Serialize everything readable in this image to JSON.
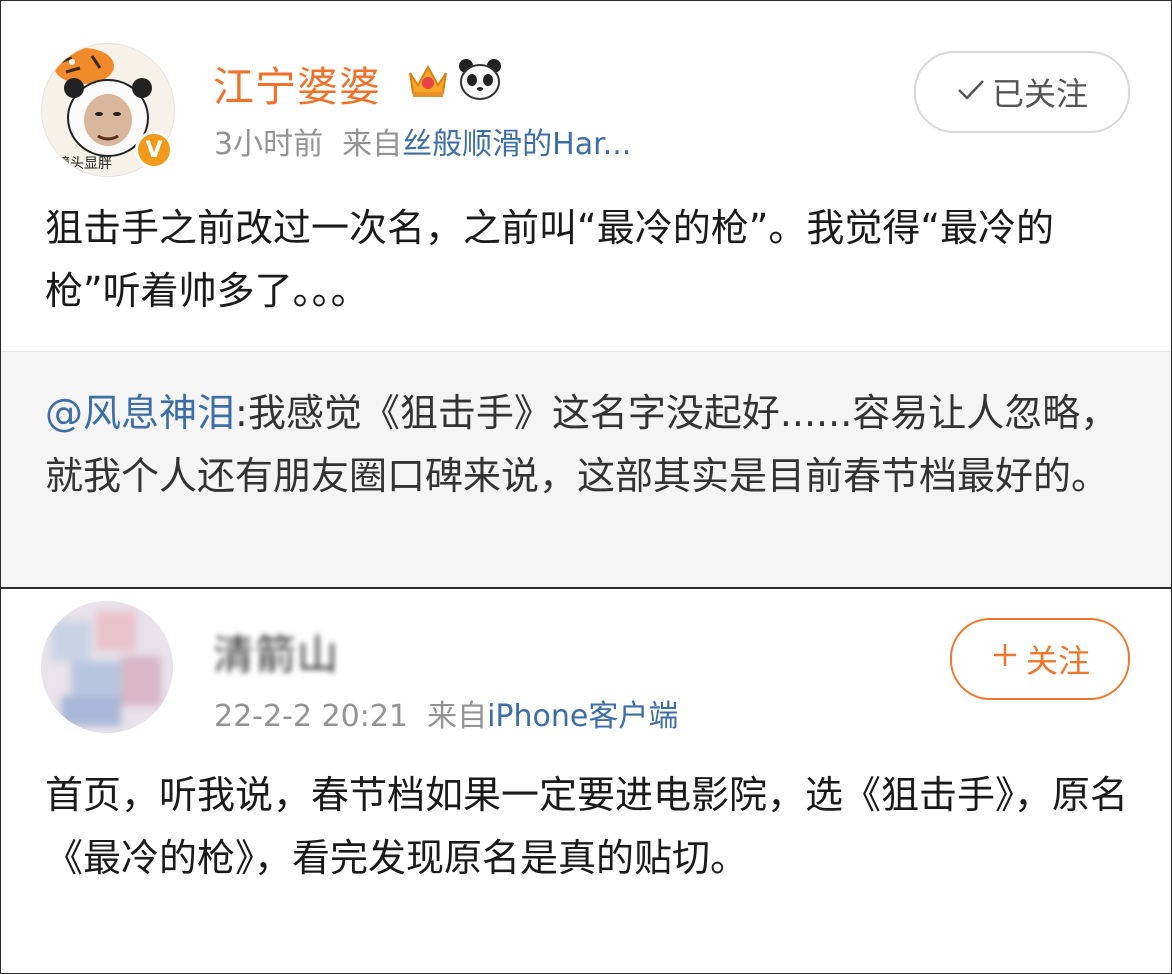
{
  "post1": {
    "avatar_caption": "镜头显胖",
    "username": "江宁婆婆",
    "badge_icons": [
      "crown-icon",
      "panda-icon"
    ],
    "verified_mark": "V",
    "time": "3小时前",
    "source_prefix": "来自",
    "source": "丝般顺滑的Har...",
    "follow_label": "已关注",
    "follow_icon": "check-icon",
    "text": "狙击手之前改过一次名，之前叫“最冷的枪”。我觉得“最冷的枪”听着帅多了。。。",
    "repost": {
      "mention": "@风息神泪",
      "text": ":我感觉《狙击手》这名字没起好......容易让人忽略，就我个人还有朋友圈口碑来说，这部其实是目前春节档最好的。"
    }
  },
  "post2": {
    "username": "清箭山",
    "time": "22-2-2 20:21",
    "source_prefix": "来自",
    "source": "iPhone客户端",
    "follow_label": "关注",
    "follow_icon": "plus-icon",
    "text": "首页，听我说，春节档如果一定要进电影院，选《狙击手》，原名《最冷的枪》，看完发现原名是真的贴切。"
  },
  "colors": {
    "username_vip": "#f0712a",
    "link": "#3d6ea6",
    "meta": "#939393",
    "follow_accent": "#f0762c",
    "repost_bg": "#f5f5f5"
  }
}
